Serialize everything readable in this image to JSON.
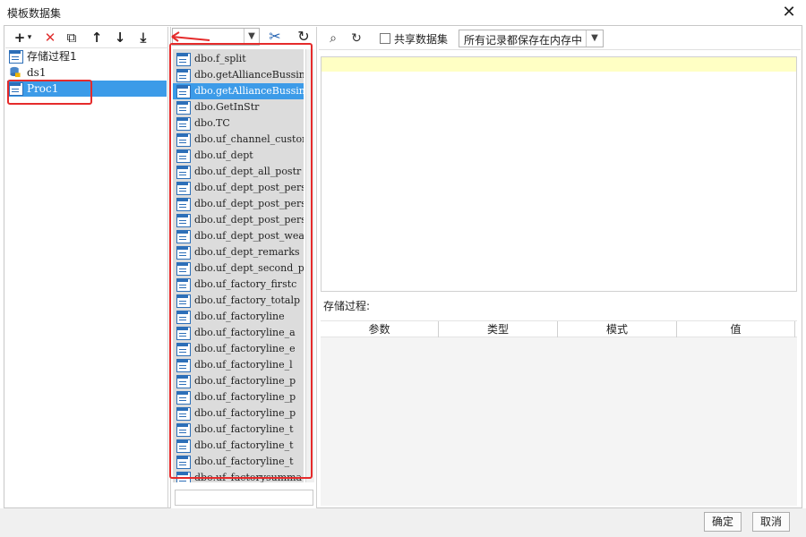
{
  "window": {
    "title": "模板数据集",
    "close_glyph": "✕"
  },
  "left_toolbar": {
    "add": "+",
    "add_caret": "▾",
    "delete": "✕",
    "copy": "⧉",
    "up": "↑",
    "down": "↓",
    "move_bottom": "⤓"
  },
  "tree": {
    "items": [
      {
        "label": "存储过程1",
        "icon": "table-icon",
        "selected": false
      },
      {
        "label": "ds1",
        "icon": "database-lock-icon",
        "selected": false
      },
      {
        "label": "Proc1",
        "icon": "table-icon",
        "selected": true
      }
    ]
  },
  "middle": {
    "combo_value": "",
    "edit_glyph": "✂",
    "refresh_glyph": "↻",
    "procedures": [
      "dbo.f_split",
      "dbo.getAllianceBussin",
      "dbo.getAllianceBussin",
      "dbo.GetInStr",
      "dbo.TC",
      "dbo.uf_channel_custom",
      "dbo.uf_dept",
      "dbo.uf_dept_all_postr",
      "dbo.uf_dept_post_pers",
      "dbo.uf_dept_post_pers",
      "dbo.uf_dept_post_pers",
      "dbo.uf_dept_post_weav",
      "dbo.uf_dept_remarks",
      "dbo.uf_dept_second_p",
      "dbo.uf_factory_firstc",
      "dbo.uf_factory_totalp",
      "dbo.uf_factoryline",
      "dbo.uf_factoryline_a",
      "dbo.uf_factoryline_e",
      "dbo.uf_factoryline_l",
      "dbo.uf_factoryline_p",
      "dbo.uf_factoryline_p",
      "dbo.uf_factoryline_p",
      "dbo.uf_factoryline_t",
      "dbo.uf_factoryline_t",
      "dbo.uf_factoryline_t",
      "dbo.uf_factorysumma"
    ],
    "selected_index": 2
  },
  "right_toolbar": {
    "preview_glyph": "⌕",
    "refresh_glyph": "↻",
    "share_label": "共享数据集",
    "share_checked": false,
    "storage_mode": "所有记录都保存在内存中"
  },
  "proc_section": {
    "label": "存储过程:",
    "columns": [
      "参数",
      "类型",
      "模式",
      "值"
    ]
  },
  "buttons": {
    "ok": "确定",
    "cancel": "取消"
  }
}
